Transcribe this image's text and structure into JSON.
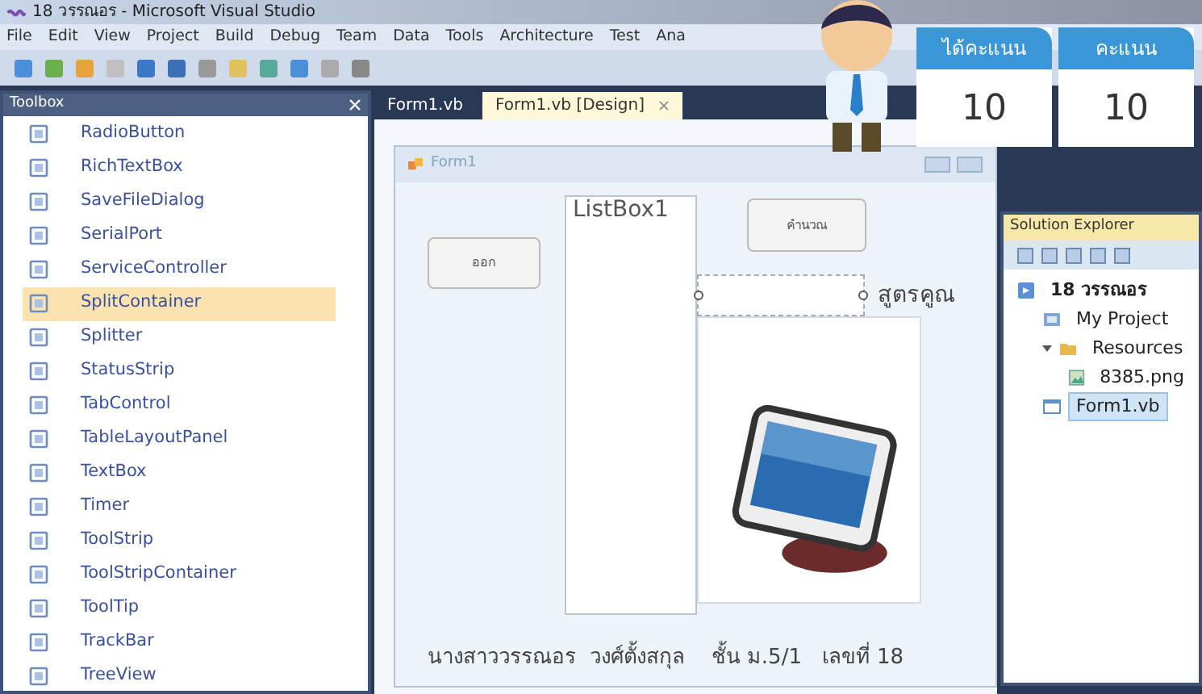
{
  "window": {
    "title": "18 วรรณอร - Microsoft Visual Studio"
  },
  "menu": [
    "File",
    "Edit",
    "View",
    "Project",
    "Build",
    "Debug",
    "Team",
    "Data",
    "Tools",
    "Architecture",
    "Test",
    "Ana"
  ],
  "toolbox": {
    "title": "Toolbox",
    "items": [
      {
        "label": "RadioButton",
        "selected": false
      },
      {
        "label": "RichTextBox",
        "selected": false
      },
      {
        "label": "SaveFileDialog",
        "selected": false
      },
      {
        "label": "SerialPort",
        "selected": false
      },
      {
        "label": "ServiceController",
        "selected": false
      },
      {
        "label": "SplitContainer",
        "selected": true
      },
      {
        "label": "Splitter",
        "selected": false
      },
      {
        "label": "StatusStrip",
        "selected": false
      },
      {
        "label": "TabControl",
        "selected": false
      },
      {
        "label": "TableLayoutPanel",
        "selected": false
      },
      {
        "label": "TextBox",
        "selected": false
      },
      {
        "label": "Timer",
        "selected": false
      },
      {
        "label": "ToolStrip",
        "selected": false
      },
      {
        "label": "ToolStripContainer",
        "selected": false
      },
      {
        "label": "ToolTip",
        "selected": false
      },
      {
        "label": "TrackBar",
        "selected": false
      },
      {
        "label": "TreeView",
        "selected": false
      }
    ]
  },
  "document_tabs": [
    {
      "label": "Form1.vb",
      "selected": false
    },
    {
      "label": "Form1.vb [Design]",
      "selected": true
    }
  ],
  "form": {
    "title": "Form1",
    "listbox": "ListBox1",
    "exit_button": "ออก",
    "calc_button": "คำนวณ",
    "label": "สูตรคูณ",
    "footer": "นางสาววรรณอร  วงศ์ตั้งสกุล    ชั้น ม.5/1   เลขที่ 18"
  },
  "solution_explorer": {
    "title": "Solution Explorer",
    "tree": [
      {
        "label": "18 วรรณอร",
        "kind": "solution",
        "selected": false,
        "children": [
          {
            "label": "My Project",
            "kind": "project",
            "selected": false
          },
          {
            "label": "Resources",
            "kind": "folder",
            "selected": false,
            "children": [
              {
                "label": "8385.png",
                "kind": "image",
                "selected": false
              }
            ]
          },
          {
            "label": "Form1.vb",
            "kind": "form",
            "selected": true
          }
        ]
      }
    ]
  },
  "score_cards": [
    {
      "header": "ได้คะแนน",
      "value": "10"
    },
    {
      "header": "คะแนน",
      "value": "10"
    }
  ]
}
